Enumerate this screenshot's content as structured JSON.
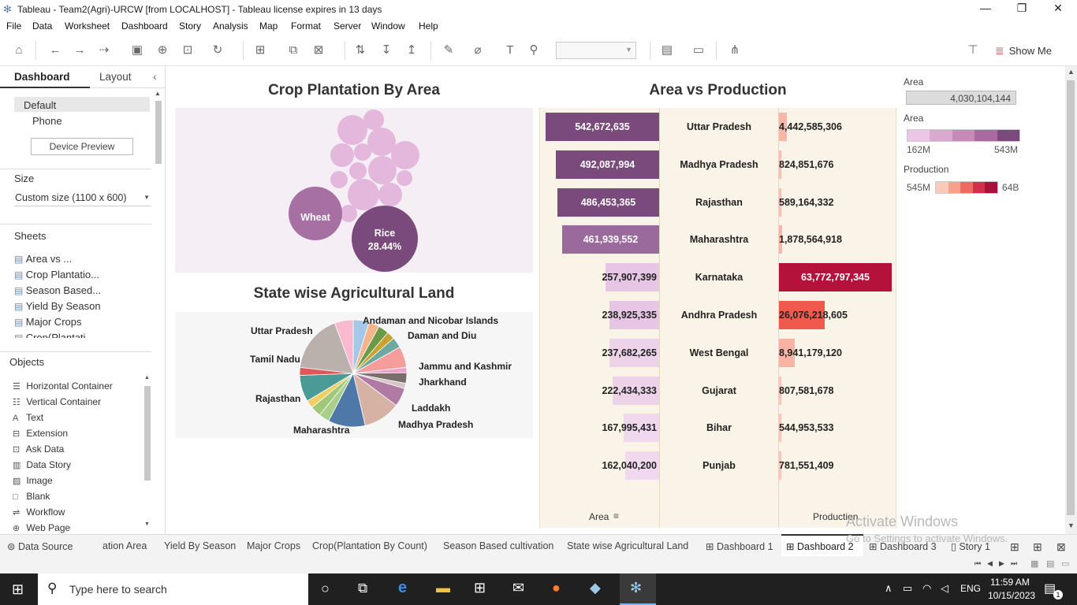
{
  "window": {
    "title": "Tableau - Team2(Agri)-URCW [from LOCALHOST] - Tableau license expires in 13 days",
    "min": "—",
    "max": "❐",
    "close": "✕"
  },
  "menu": [
    "File",
    "Data",
    "Worksheet",
    "Dashboard",
    "Story",
    "Analysis",
    "Map",
    "Format",
    "Server",
    "Window",
    "Help"
  ],
  "toolbar": {
    "show_me": "Show Me"
  },
  "left": {
    "tab_dashboard": "Dashboard",
    "tab_layout": "Layout",
    "device_default": "Default",
    "device_phone": "Phone",
    "device_preview": "Device Preview",
    "size_heading": "Size",
    "size_value": "Custom size (1100 x 600)",
    "sheets_heading": "Sheets",
    "sheets": [
      "Area vs ...",
      "Crop Plantatio...",
      "Season Based...",
      "Yield By Season",
      "Major Crops",
      "Crop(Plantati..."
    ],
    "objects_heading": "Objects",
    "objects": [
      "Horizontal Container",
      "Vertical Container",
      "Text",
      "Extension",
      "Ask Data",
      "Data Story",
      "Image",
      "Blank",
      "Workflow",
      "Web Page"
    ]
  },
  "dash": {
    "title_crop": "Crop Plantation By Area",
    "title_state": "State wise Agricultural Land",
    "title_avp": "Area vs Production",
    "bubble_wheat": "Wheat",
    "bubble_rice": "Rice",
    "bubble_rice_pct": "28.44%",
    "pie_labels": [
      "Uttar Pradesh",
      "Andaman and Nicobar Islands",
      "Daman and Diu",
      "Tamil Nadu",
      "Jammu and Kashmir",
      "Jharkhand",
      "Rajasthan",
      "Laddakh",
      "Madhya Pradesh",
      "Maharashtra"
    ],
    "axis_area": "Area",
    "axis_production": "Production",
    "sort_icon": "sort-icon"
  },
  "chart_data": {
    "type": "bar",
    "title": "Area vs Production",
    "categories": [
      "Uttar Pradesh",
      "Madhya Pradesh",
      "Rajasthan",
      "Maharashtra",
      "Karnataka",
      "Andhra Pradesh",
      "West Bengal",
      "Gujarat",
      "Bihar",
      "Punjab"
    ],
    "series": [
      {
        "name": "Area",
        "values": [
          542672635,
          492087994,
          486453365,
          461939552,
          257907399,
          238925335,
          237682265,
          222434333,
          167995431,
          162040200
        ],
        "labels": [
          "542,672,635",
          "492,087,994",
          "486,453,365",
          "461,939,552",
          "257,907,399",
          "238,925,335",
          "237,682,265",
          "222,434,333",
          "167,995,431",
          "162,040,200"
        ]
      },
      {
        "name": "Production",
        "values": [
          4442585306,
          824851676,
          589164332,
          1878564918,
          63772797345,
          26076218605,
          8941179120,
          807581678,
          544953533,
          781551409
        ],
        "labels": [
          "4,442,585,306",
          "824,851,676",
          "589,164,332",
          "1,878,564,918",
          "63,772,797,345",
          "26,076,218,605",
          "8,941,179,120",
          "807,581,678",
          "544,953,533",
          "781,551,409"
        ]
      }
    ],
    "area_colors": [
      "#7b4a7c",
      "#7b4a7c",
      "#7b4a7c",
      "#9a6a9c",
      "#e6c6e4",
      "#e6c6e4",
      "#edd3ea",
      "#edd3ea",
      "#f0d8ee",
      "#f0d8ee"
    ],
    "prod_colors": [
      "#f7b6a8",
      "#f7c0b2",
      "#f7c0b2",
      "#f7b6a8",
      "#b5123b",
      "#f05a4d",
      "#f9b3a5",
      "#fbc5b8",
      "#fbc5b8",
      "#fbc5b8"
    ]
  },
  "legends": {
    "area_total_title": "Area",
    "area_total": "4,030,104,144",
    "area_title": "Area",
    "area_min": "162M",
    "area_max": "543M",
    "area_colors": [
      "#ecc7e5",
      "#d9a9cf",
      "#c48bb9",
      "#a96aa0",
      "#7b4a7c"
    ],
    "prod_title": "Production",
    "prod_min": "545M",
    "prod_max": "64B",
    "prod_colors": [
      "#fcc8b8",
      "#f7a08b",
      "#ee6a60",
      "#d2304a",
      "#a8113a"
    ]
  },
  "tabs": [
    "Data Source",
    "ation Area",
    "Yield By Season",
    "Major Crops",
    "Crop(Plantation By Count)",
    "Season Based cultivation",
    "State wise Agricultural Land",
    "Dashboard 1",
    "Dashboard 2",
    "Dashboard 3",
    "Story 1"
  ],
  "watermark": {
    "line1": "Activate Windows",
    "line2": "Go to Settings to activate Windows."
  },
  "taskbar": {
    "search_placeholder": "Type here to search",
    "lang": "ENG",
    "time": "11:59 AM",
    "date": "10/15/2023",
    "notif": "1"
  }
}
